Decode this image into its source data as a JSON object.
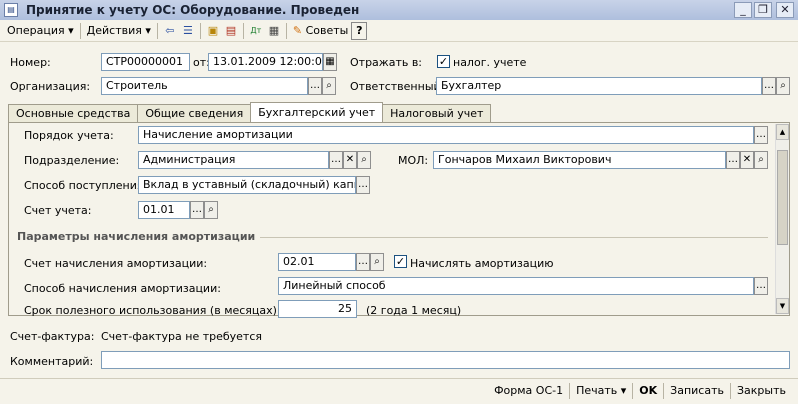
{
  "window": {
    "title": "Принятие к учету ОС: Оборудование. Проведен"
  },
  "toolbar": {
    "operation": "Операция",
    "actions": "Действия",
    "advice": "Советы",
    "help": "?"
  },
  "header": {
    "number_label": "Номер:",
    "number_value": "СТР00000001",
    "from_label": "от:",
    "date_value": "13.01.2009 12:00:03",
    "reflect_label": "Отражать в:",
    "tax_label": "налог. учете",
    "org_label": "Организация:",
    "org_value": "Строитель",
    "resp_label": "Ответственный:",
    "resp_value": "Бухгалтер"
  },
  "tabs": [
    "Основные средства",
    "Общие сведения",
    "Бухгалтерский учет",
    "Налоговый учет"
  ],
  "accounting": {
    "order_label": "Порядок учета:",
    "order_value": "Начисление амортизации",
    "dept_label": "Подразделение:",
    "dept_value": "Администрация",
    "mol_label": "МОЛ:",
    "mol_value": "Гончаров Михаил Викторович",
    "receipt_label": "Способ поступления:",
    "receipt_value": "Вклад в уставный (складочный) капитал",
    "account_label": "Счет учета:",
    "account_value": "01.01",
    "section_header": "Параметры начисления амортизации",
    "amort_account_label": "Счет начисления амортизации:",
    "amort_account_value": "02.01",
    "accrue_label": "Начислять амортизацию",
    "method_label": "Способ начисления амортизации:",
    "method_value": "Линейный способ",
    "life_label": "Срок полезного использования (в месяцах):",
    "life_value": "25",
    "life_text": "(2 года 1 месяц)"
  },
  "footer": {
    "invoice_label": "Счет-фактура:",
    "invoice_value": "Счет-фактура не требуется",
    "comment_label": "Комментарий:",
    "comment_value": ""
  },
  "bottombar": {
    "form": "Форма ОС-1",
    "print": "Печать",
    "ok": "OK",
    "save": "Записать",
    "close": "Закрыть"
  }
}
